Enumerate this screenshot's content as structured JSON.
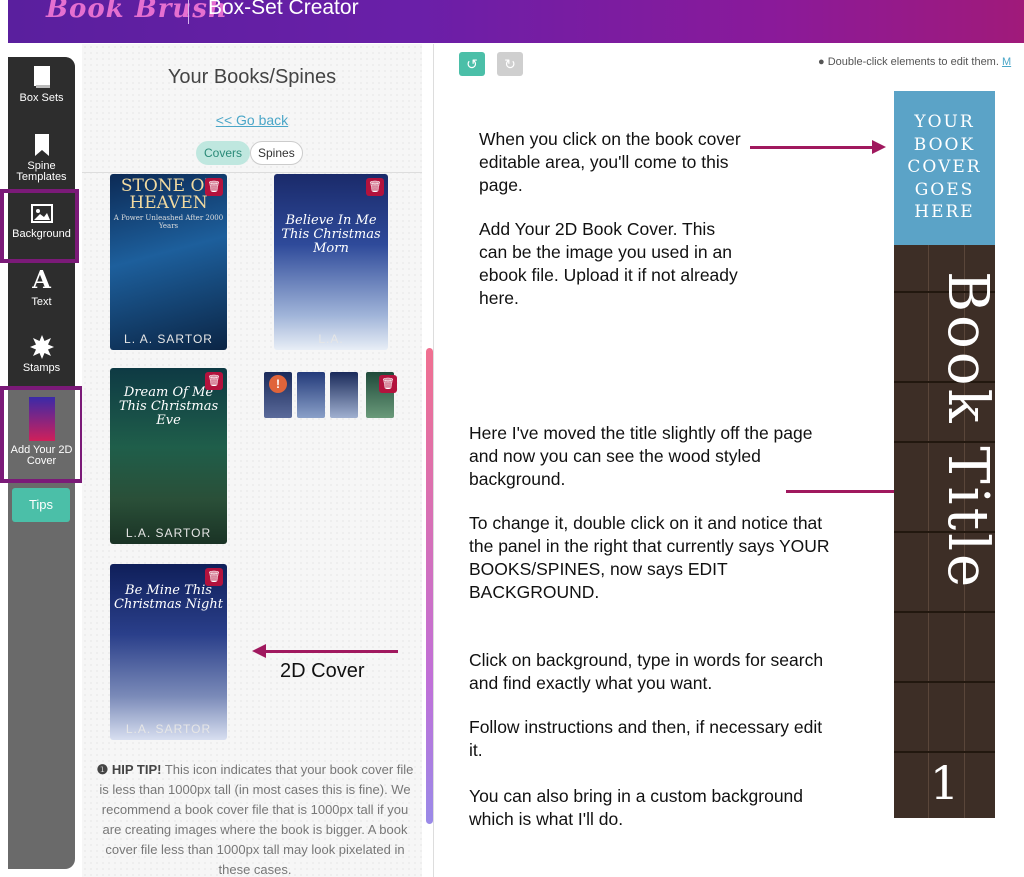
{
  "header": {
    "logo": "Book Brush",
    "title": "Box-Set Creator"
  },
  "nav": {
    "box_sets": "Box Sets",
    "spine_templates_1": "Spine",
    "spine_templates_2": "Templates",
    "background": "Background",
    "text": "Text",
    "stamps": "Stamps",
    "add_cover_1": "Add Your 2D",
    "add_cover_2": "Cover",
    "tips": "Tips"
  },
  "panel": {
    "title": "Your Books/Spines",
    "go_back": "<< Go back",
    "tab_covers": "Covers",
    "tab_spines": "Spines",
    "covers": [
      {
        "title": "STONE OF HEAVEN",
        "subtitle": "A Power Unleashed After 2000 Years",
        "author": "L. A. SARTOR"
      },
      {
        "title": "Believe In Me This Christmas Morn",
        "author": "L.A."
      },
      {
        "title": "Dream Of Me This Christmas Eve",
        "author": "L.A. SARTOR"
      },
      {
        "title": "Be Mine This Christmas Night",
        "author": "L.A. SARTOR"
      }
    ],
    "hip_tip_label": "HIP TIP!",
    "hip_tip_text": " This icon indicates that your book cover file is less than 1000px tall (in most cases this is fine). We recommend a book cover file that is 1000px tall if you are creating images where the book is bigger. A book cover file less than 1000px tall may look pixelated in these cases."
  },
  "canvas": {
    "hint_text": "Double-click elements to edit them.",
    "hint_link": "M",
    "annotation_1": "When you click on the book cover editable area, you'll come to this page.",
    "annotation_2": "Add Your 2D Book Cover. This can be the image you used in an ebook file. Upload it if not already here.",
    "annotation_3": "Here I've moved the title slightly off the page and now you can see the wood styled background.",
    "annotation_4": "To change it, double click on it and notice that the panel in the right that currently says YOUR BOOKS/SPINES, now says EDIT BACKGROUND.",
    "annotation_5": "Click on background, type in words for search and find exactly what you want.",
    "annotation_6": "Follow instructions and then, if necessary edit it.",
    "annotation_7": "You can also bring in a custom background which is what I'll do.",
    "cover_label": "2D Cover",
    "spine_top_text": "YOUR BOOK COVER GOES HERE",
    "spine_title": "Book Title",
    "spine_number": "1"
  }
}
